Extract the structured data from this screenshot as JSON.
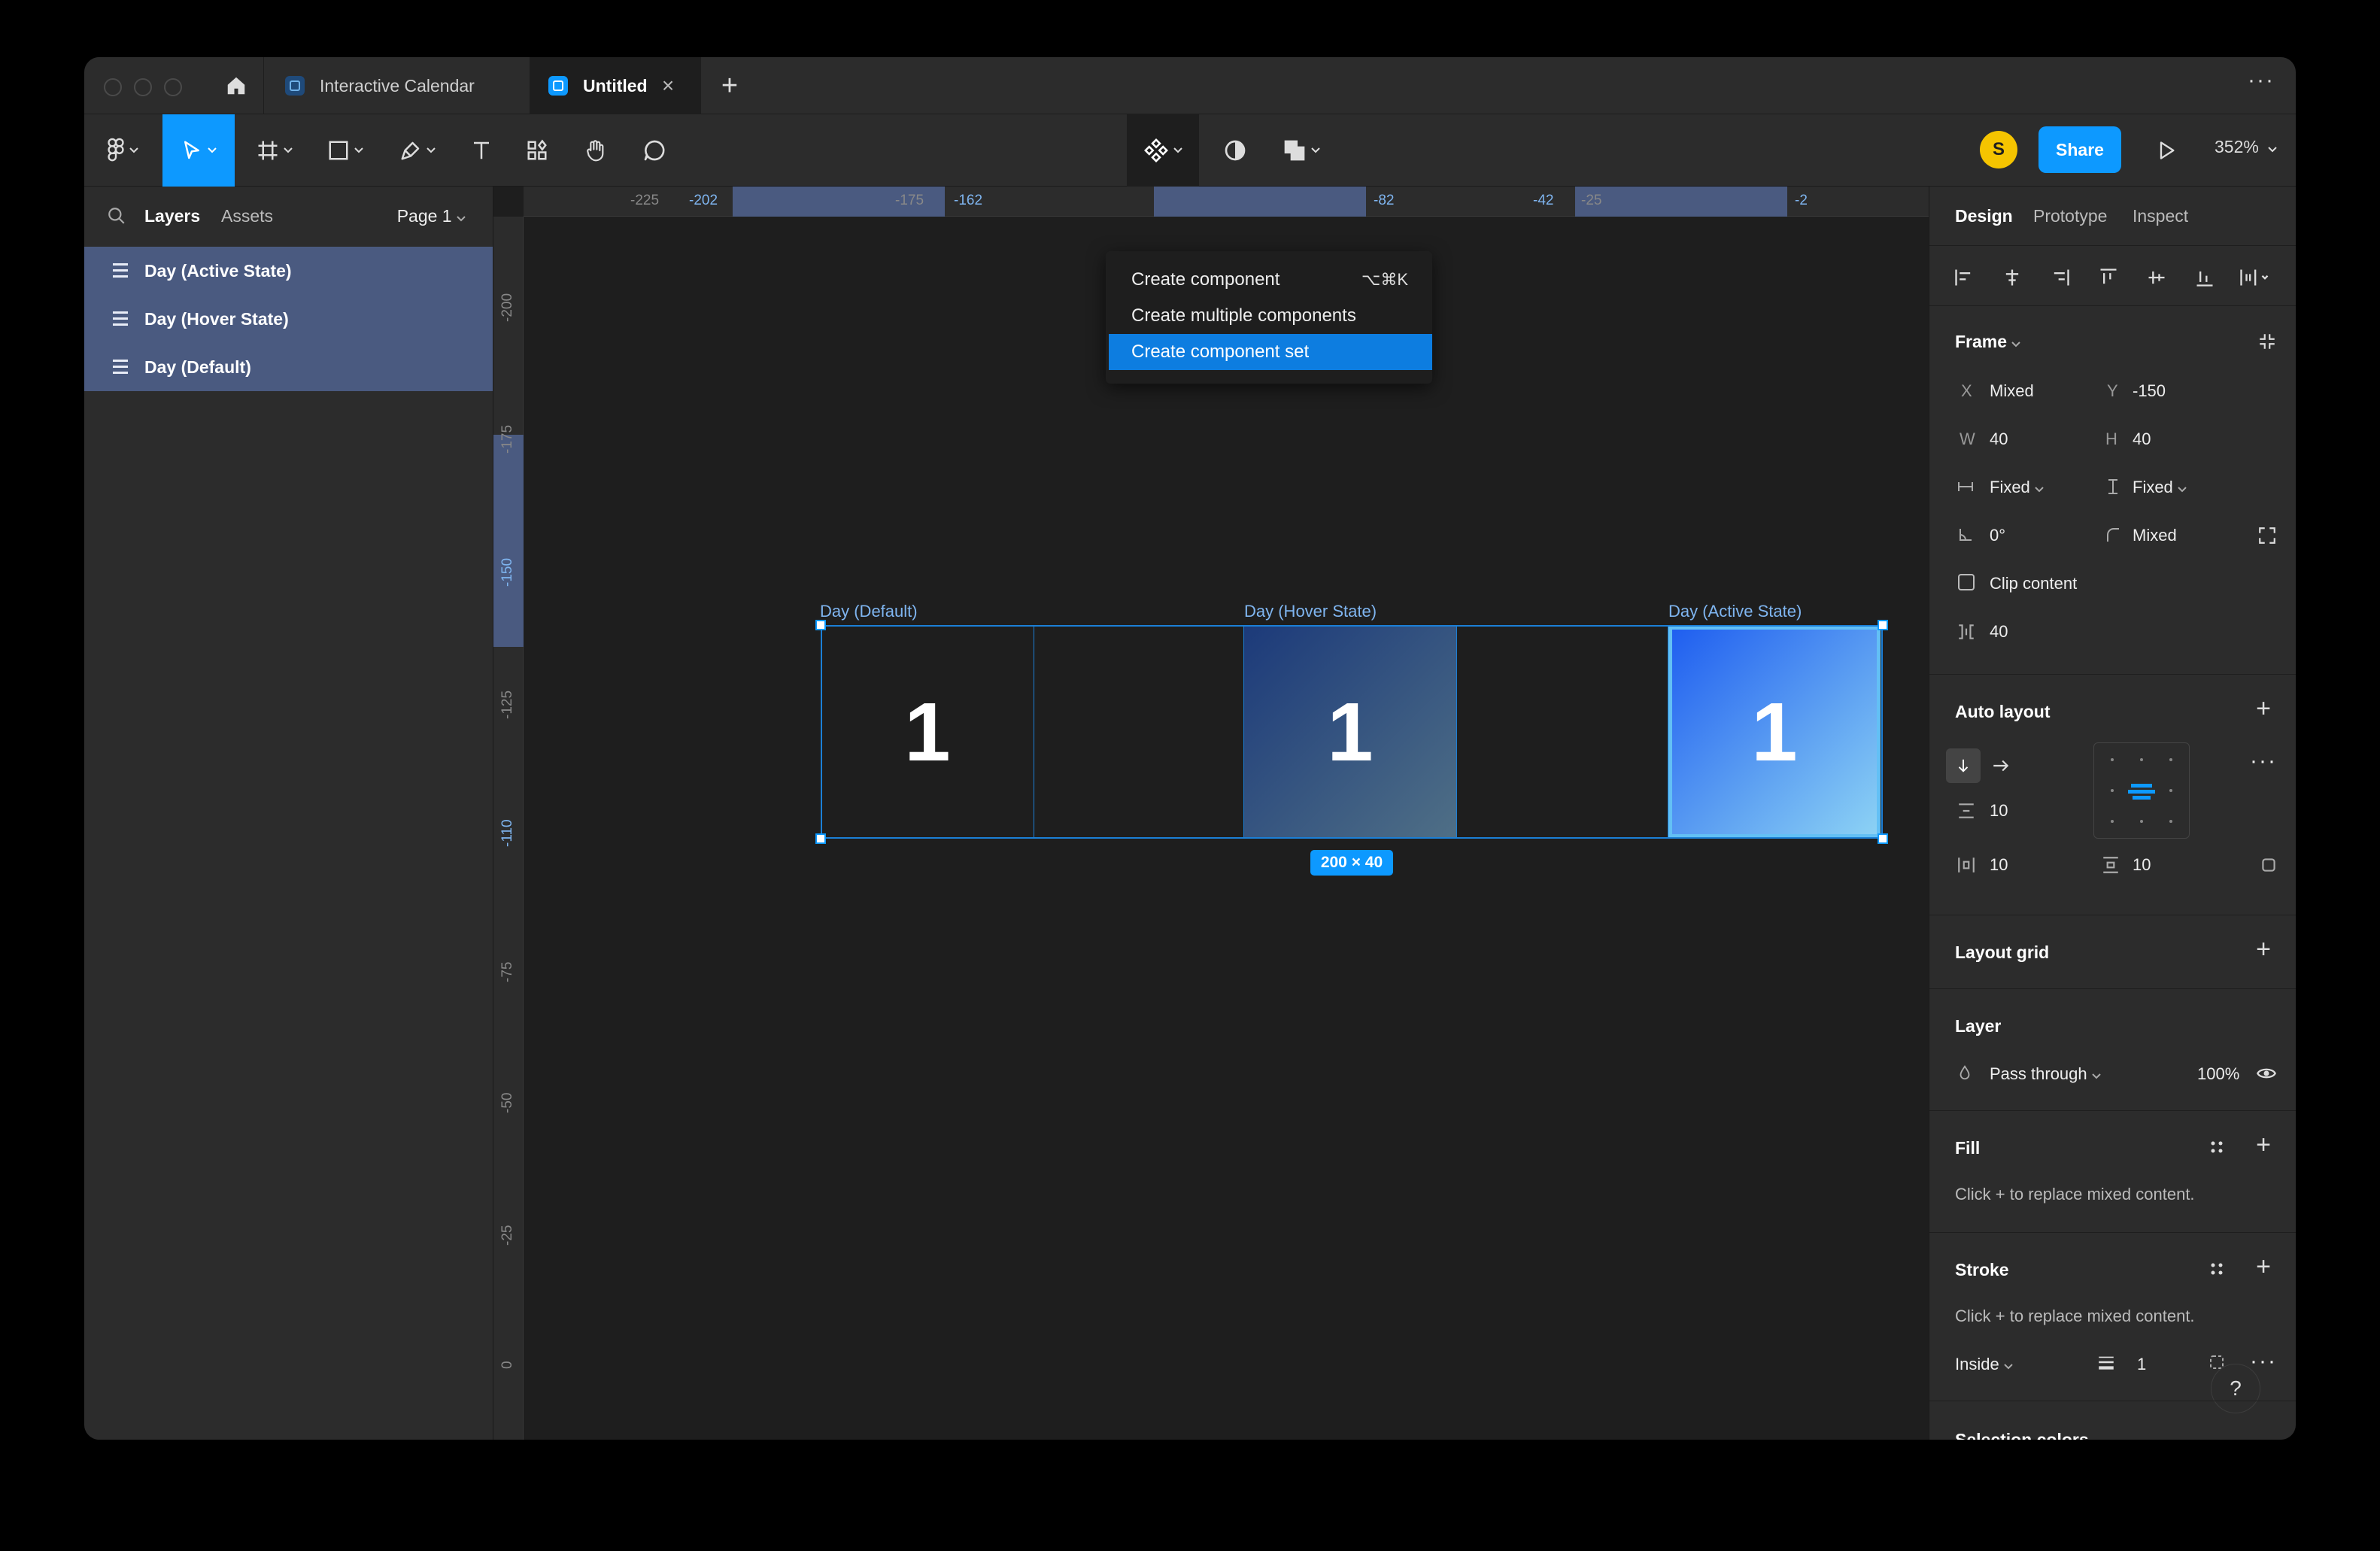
{
  "tabs": [
    {
      "label": "Interactive Calendar"
    },
    {
      "label": "Untitled",
      "close": "×"
    }
  ],
  "new_tab_label": "+",
  "more_label": "···",
  "toolbar": {
    "avatar_initial": "S",
    "share_label": "Share",
    "zoom_label": "352%"
  },
  "left_panel": {
    "tab_layers": "Layers",
    "tab_assets": "Assets",
    "page_label": "Page 1",
    "layers": [
      {
        "name": "Day (Active State)"
      },
      {
        "name": "Day (Hover State)"
      },
      {
        "name": "Day (Default)"
      }
    ]
  },
  "ruler": {
    "h_labels": [
      "-225",
      "-202",
      "-175",
      "-162",
      "-82",
      "-42",
      "-25",
      "-2"
    ],
    "v_labels": [
      "-200",
      "-175",
      "-150",
      "-125",
      "-110",
      "-75",
      "-50",
      "-25",
      "0"
    ]
  },
  "canvas": {
    "frames": [
      {
        "label": "Day (Default)",
        "digit": "1"
      },
      {
        "label": "Day (Hover State)",
        "digit": "1"
      },
      {
        "label": "Day (Active State)",
        "digit": "1"
      }
    ],
    "size_badge": "200 × 40"
  },
  "menu": {
    "items": [
      {
        "label": "Create component",
        "shortcut": "⌥⌘K"
      },
      {
        "label": "Create multiple components"
      },
      {
        "label": "Create component set"
      }
    ]
  },
  "right_panel": {
    "tab_design": "Design",
    "tab_prototype": "Prototype",
    "tab_inspect": "Inspect",
    "frame": {
      "title": "Frame",
      "x_label": "X",
      "x_value": "Mixed",
      "y_label": "Y",
      "y_value": "-150",
      "w_label": "W",
      "w_value": "40",
      "h_label": "H",
      "h_value": "40",
      "hsize": "Fixed",
      "vsize": "Fixed",
      "rotation": "0°",
      "radius": "Mixed",
      "clip_label": "Clip content",
      "gap": "40"
    },
    "auto_layout": {
      "title": "Auto layout",
      "spacing": "10",
      "pad_h": "10",
      "pad_v": "10"
    },
    "layout_grid": {
      "title": "Layout grid"
    },
    "layer": {
      "title": "Layer",
      "blend": "Pass through",
      "opacity": "100%"
    },
    "fill": {
      "title": "Fill",
      "note": "Click + to replace mixed content."
    },
    "stroke": {
      "title": "Stroke",
      "note": "Click + to replace mixed content.",
      "position": "Inside",
      "weight": "1"
    },
    "selection_colors": {
      "title": "Selection colors"
    },
    "help": "?"
  },
  "colors": {
    "accent": "#0d99ff",
    "hover_gradient": [
      "#1c3a7a",
      "#4f6f86"
    ],
    "active_gradient": [
      "#1d5cf0",
      "#8ed4f4"
    ]
  }
}
